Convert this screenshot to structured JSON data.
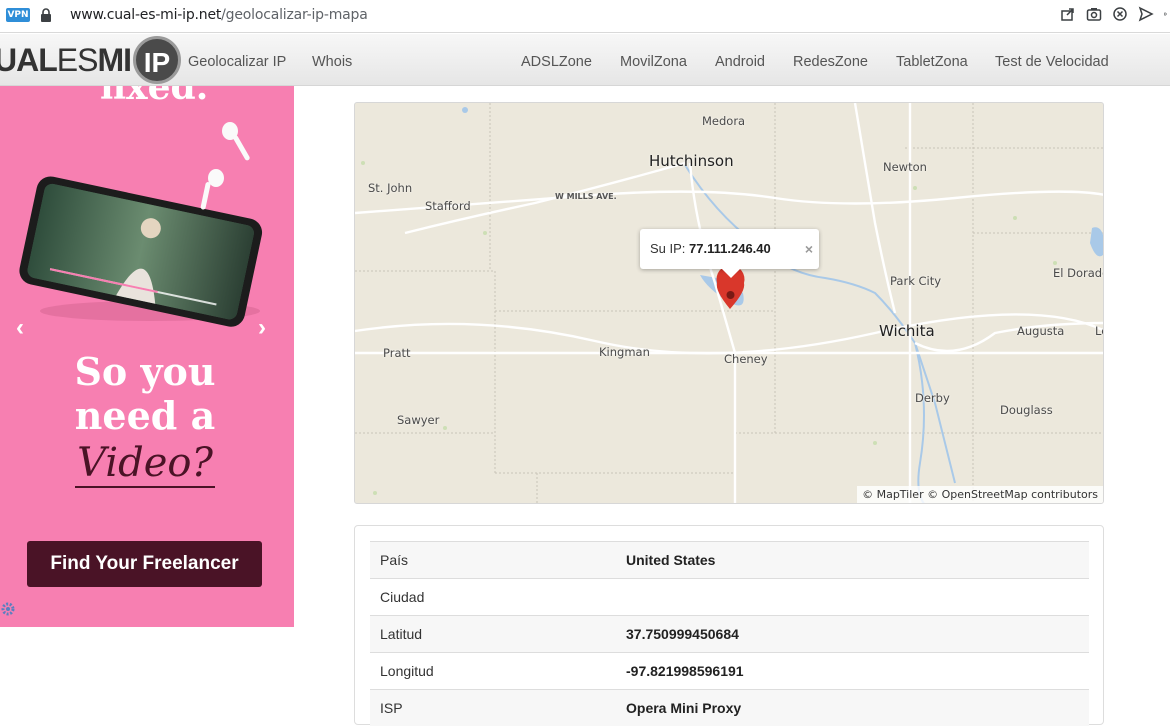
{
  "browser": {
    "vpn_badge": "VPN",
    "url_host": "www.cual-es-mi-ip.net",
    "url_path": "/geolocalizar-ip-mapa"
  },
  "site": {
    "logo_left": "UAL",
    "logo_mid": "ES",
    "logo_right": "MI",
    "logo_circle": "IP",
    "nav": [
      "Geolocalizar IP",
      "Whois",
      "ADSLZone",
      "MovilZona",
      "Android",
      "RedesZone",
      "TabletZona",
      "Test de Velocidad"
    ]
  },
  "ad": {
    "cut_text": "fixed.",
    "headline_1": "So you",
    "headline_2": "need a",
    "headline_em": "Video?",
    "cta": "Find Your Freelancer",
    "prev": "‹",
    "next": "›"
  },
  "map": {
    "places": {
      "medora": "Medora",
      "hutchinson": "Hutchinson",
      "newton": "Newton",
      "st_john": "St. John",
      "stafford": "Stafford",
      "w_mills": "W MILLS AVE.",
      "park_city": "Park City",
      "el_dorado": "El Dorado",
      "wichita": "Wichita",
      "augusta": "Augusta",
      "le": "Le",
      "pratt": "Pratt",
      "kingman": "Kingman",
      "cheney": "Cheney",
      "derby": "Derby",
      "douglass": "Douglass",
      "sawyer": "Sawyer"
    },
    "popup_label": "Su IP:",
    "popup_ip": "77.111.246.40",
    "popup_close": "×",
    "attribution": "© MapTiler © OpenStreetMap contributors",
    "marker_color": "#d9372b",
    "water_color": "#a9c9e8"
  },
  "info": {
    "rows": [
      {
        "label": "País",
        "value": "United States"
      },
      {
        "label": "Ciudad",
        "value": ""
      },
      {
        "label": "Latitud",
        "value": "37.750999450684"
      },
      {
        "label": "Longitud",
        "value": "-97.821998596191"
      },
      {
        "label": "ISP",
        "value": "Opera Mini Proxy"
      }
    ]
  }
}
